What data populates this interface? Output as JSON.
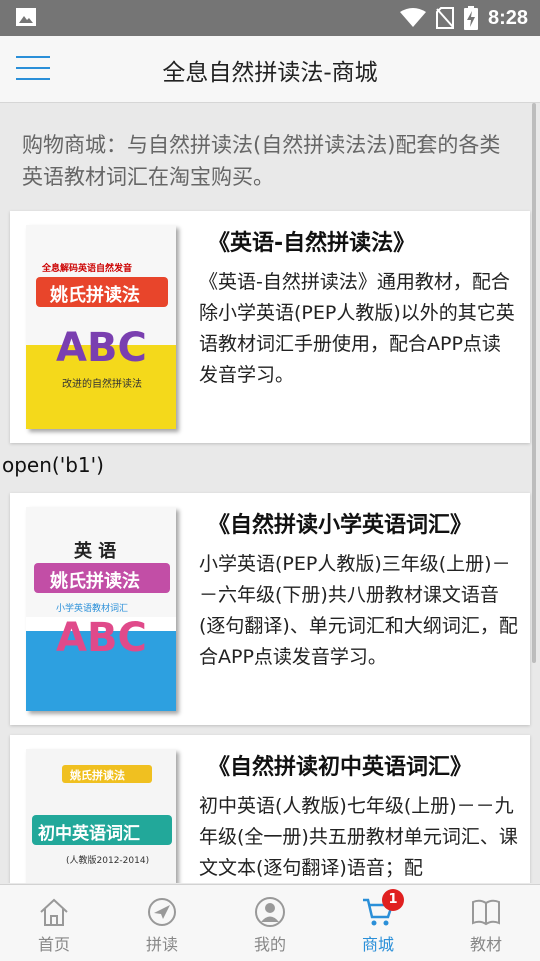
{
  "status_bar": {
    "time": "8:28"
  },
  "header": {
    "title": "全息自然拼读法-商城"
  },
  "intro": "购物商城：与自然拼读法(自然拼读法法)配套的各类英语教材词汇在淘宝购买。",
  "debug_text": "open('b1')",
  "cards": [
    {
      "title": "《英语-自然拼读法》",
      "desc": "《英语-自然拼读法》通用教材，配合除小学英语(PEP人教版)以外的其它英语教材词汇手册使用，配合APP点读发音学习。",
      "cover": {
        "series": "全息解码英语自然发音",
        "name": "姚氏拼读法",
        "abc": "ABC",
        "sub": "改进的自然拼读法"
      }
    },
    {
      "title": "《自然拼读小学英语词汇》",
      "desc": "小学英语(PEP人教版)三年级(上册)－－六年级(下册)共八册教材课文语音(逐句翻译)、单元词汇和大纲词汇，配合APP点读发音学习。",
      "cover": {
        "series": "英 语",
        "name": "姚氏拼读法",
        "abc": "ABC",
        "sub": "小学英语教材词汇"
      }
    },
    {
      "title": "《自然拼读初中英语词汇》",
      "desc": "初中英语(人教版)七年级(上册)－－九年级(全一册)共五册教材单元词汇、课文文本(逐句翻译)语音；配",
      "cover": {
        "series": "姚氏拼读法",
        "name": "初中英语词汇",
        "sub": "(人教版2012-2014)"
      }
    }
  ],
  "tabs": [
    {
      "label": "首页",
      "icon": "home-icon"
    },
    {
      "label": "拼读",
      "icon": "compass-icon"
    },
    {
      "label": "我的",
      "icon": "user-icon"
    },
    {
      "label": "商城",
      "icon": "cart-icon",
      "badge": "1",
      "active": true
    },
    {
      "label": "教材",
      "icon": "book-icon"
    }
  ],
  "colors": {
    "accent": "#2a8fd8",
    "badge": "#e02020",
    "statusbar": "#757575"
  }
}
